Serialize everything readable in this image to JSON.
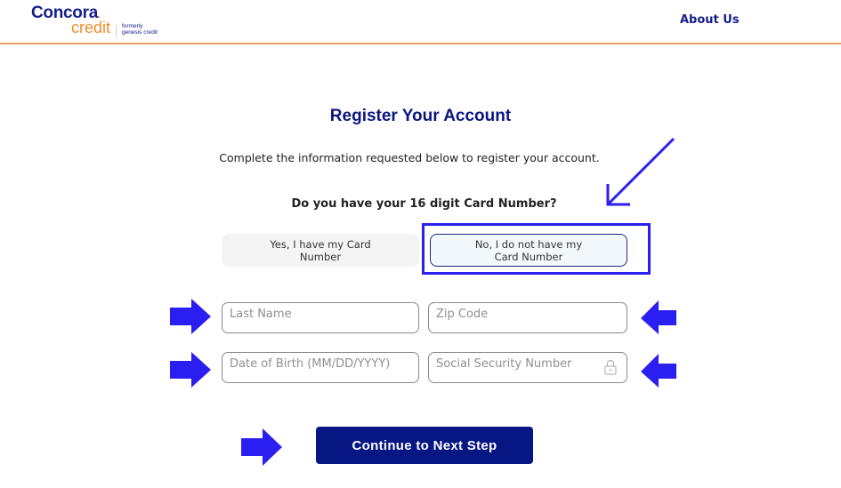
{
  "header": {
    "logo": {
      "brand": "Concora",
      "product": "credit",
      "formerly_line1": "formerly",
      "formerly_line2": "genesis credit"
    },
    "nav": {
      "about_label": "About Us"
    }
  },
  "page": {
    "title": "Register Your Account",
    "subtitle": "Complete the information requested below to register your account.",
    "question": "Do you have your 16 digit Card Number?"
  },
  "card_options": {
    "yes_line1": "Yes, I have my Card",
    "yes_line2": "Number",
    "no_line1": "No, I do not have my",
    "no_line2": "Card Number",
    "selected": "no"
  },
  "form": {
    "last_name": {
      "value": "",
      "placeholder": "Last Name"
    },
    "zip_code": {
      "value": "",
      "placeholder": "Zip Code"
    },
    "dob": {
      "value": "",
      "placeholder": "Date of Birth (MM/DD/YYYY)"
    },
    "ssn": {
      "value": "",
      "placeholder": "Social Security Number",
      "icon": "lock-icon"
    }
  },
  "actions": {
    "continue_label": "Continue to Next Step"
  },
  "annotations": {
    "arrow_color": "#2a1ff0",
    "highlight_color": "#2a1ff0"
  },
  "colors": {
    "brand_navy": "#17208a",
    "brand_orange": "#f28c2b",
    "button_navy": "#061683"
  }
}
